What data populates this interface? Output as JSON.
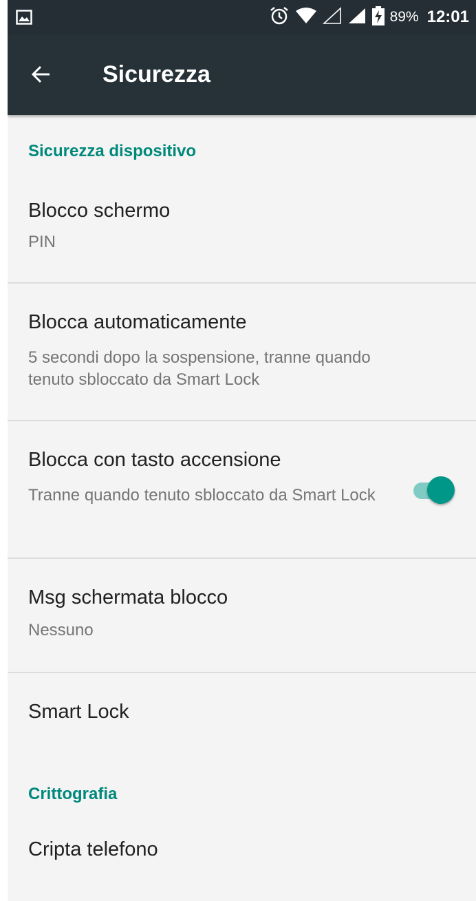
{
  "status_bar": {
    "battery_percent": "89%",
    "time": "12:01",
    "icons": [
      "image-notification-icon",
      "alarm-icon",
      "wifi-icon",
      "signal-empty-icon",
      "signal-icon",
      "battery-charging-icon"
    ]
  },
  "app_bar": {
    "title": "Sicurezza",
    "back_icon": "arrow-back-icon"
  },
  "sections": {
    "device_security": "Sicurezza dispositivo",
    "encryption": "Crittografia"
  },
  "items": {
    "screen_lock": {
      "title": "Blocco schermo",
      "summary": "PIN"
    },
    "auto_lock": {
      "title": "Blocca automaticamente",
      "summary": "5 secondi dopo la sospensione, tranne quando tenuto sbloccato da Smart Lock"
    },
    "power_button_lock": {
      "title": "Blocca con tasto accensione",
      "summary": "Tranne quando tenuto sbloccato da Smart Lock",
      "enabled": true
    },
    "lockscreen_message": {
      "title": "Msg schermata blocco",
      "summary": "Nessuno"
    },
    "smart_lock": {
      "title": "Smart Lock"
    },
    "encrypt_phone": {
      "title": "Cripta telefono"
    }
  },
  "colors": {
    "app_bar": "#263238",
    "accent": "#00897b",
    "switch_thumb": "#009688",
    "switch_track": "#80cbc4",
    "background": "#f4f4f4"
  }
}
